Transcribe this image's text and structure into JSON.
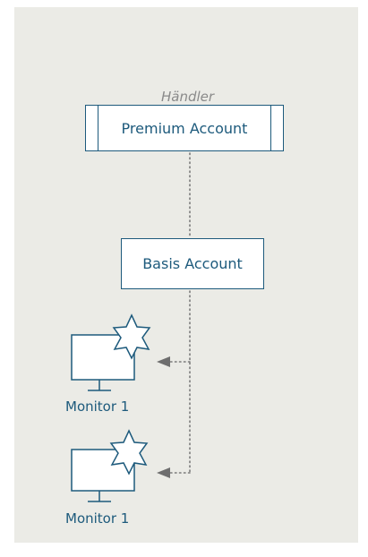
{
  "diagram": {
    "role_label": "Händler",
    "premium_account": "Premium Account",
    "basis_account": "Basis Account",
    "monitors": [
      {
        "label": "Monitor 1"
      },
      {
        "label": "Monitor 1"
      }
    ]
  },
  "colors": {
    "background": "#ebebe6",
    "stroke": "#1d5a7c",
    "connector": "#7a7a7a",
    "muted_text": "#8a8a8a"
  }
}
